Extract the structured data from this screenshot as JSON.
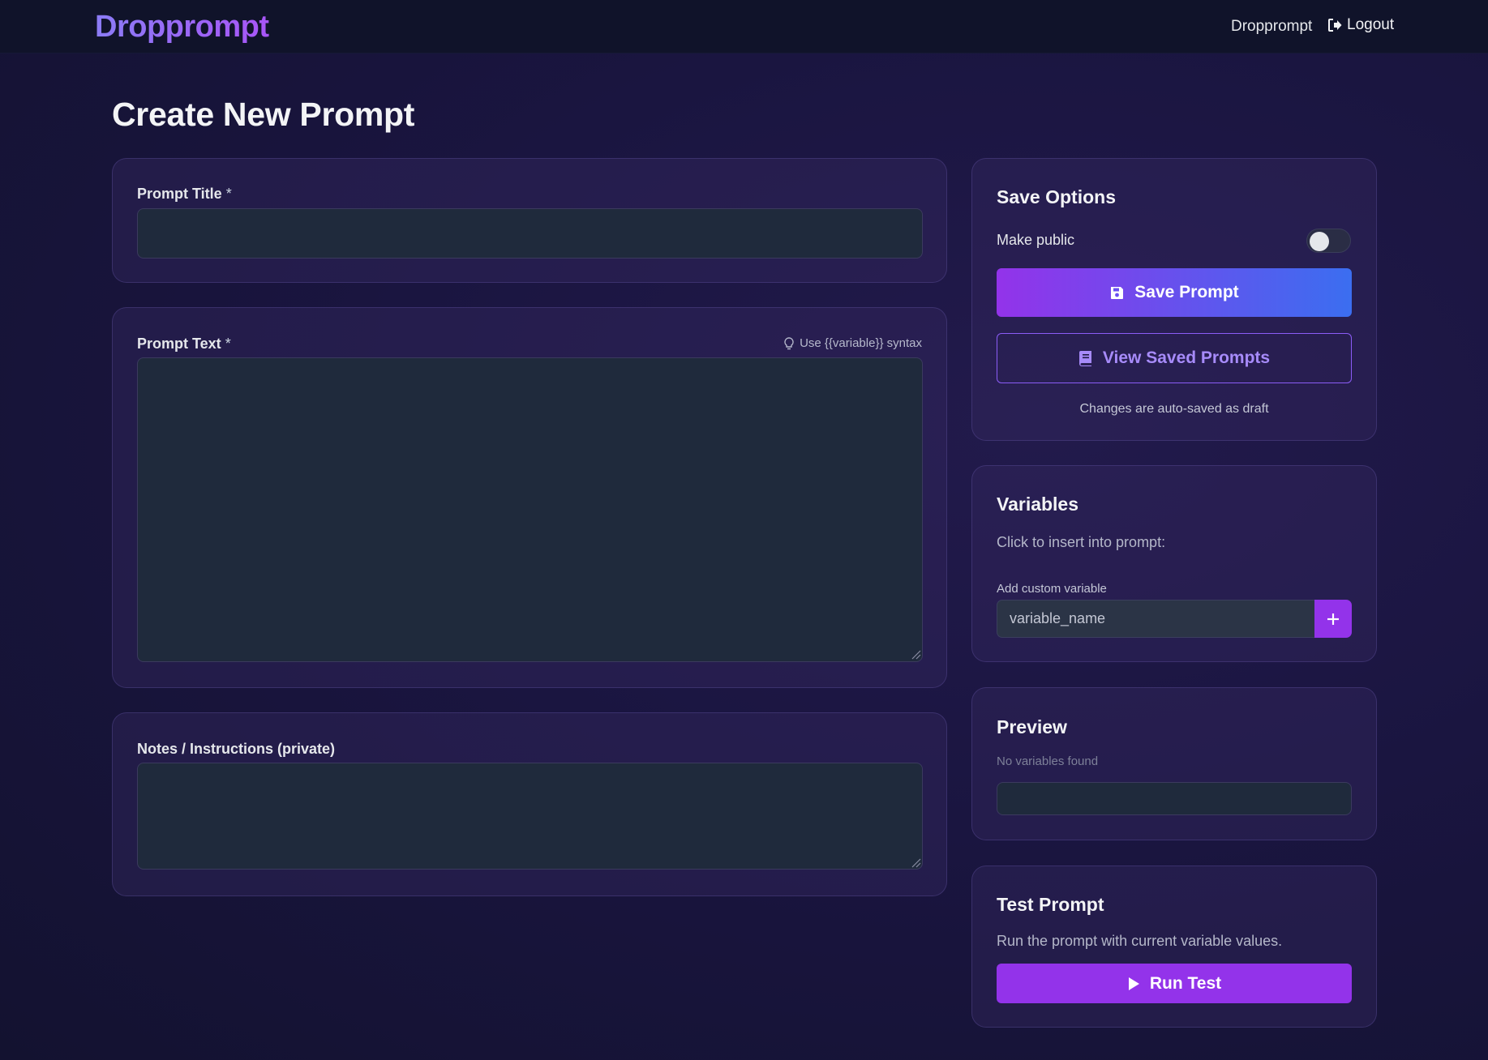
{
  "header": {
    "brand": "Dropprompt",
    "user_label": "Dropprompt",
    "logout_label": "Logout"
  },
  "page": {
    "title": "Create New Prompt"
  },
  "form": {
    "title_label": "Prompt Title",
    "title_required": "*",
    "title_value": "",
    "text_label": "Prompt Text",
    "text_required": "*",
    "text_value": "",
    "text_hint": "Use {{variable}} syntax",
    "notes_label": "Notes / Instructions (private)",
    "notes_value": ""
  },
  "save_options": {
    "title": "Save Options",
    "make_public_label": "Make public",
    "make_public": false,
    "save_button": "Save Prompt",
    "view_button": "View Saved Prompts",
    "autosave_note": "Changes are auto-saved as draft"
  },
  "variables": {
    "title": "Variables",
    "instruction": "Click to insert into prompt:",
    "custom_label": "Add custom variable",
    "custom_placeholder": "variable_name",
    "add_button": "+"
  },
  "preview": {
    "title": "Preview",
    "status": "No variables found",
    "value": ""
  },
  "test": {
    "title": "Test Prompt",
    "description": "Run the prompt with current variable values.",
    "run_button": "Run Test"
  },
  "colors": {
    "accent_purple": "#9333ea",
    "accent_blue": "#3b6ef0",
    "outline_purple": "#8b5cf6",
    "field_bg": "#1f2a3c"
  },
  "icons": {
    "logout": "logout-icon",
    "hint": "lightbulb-icon",
    "save": "floppy-disk-icon",
    "view": "book-icon",
    "add": "plus-icon",
    "run": "play-icon"
  }
}
